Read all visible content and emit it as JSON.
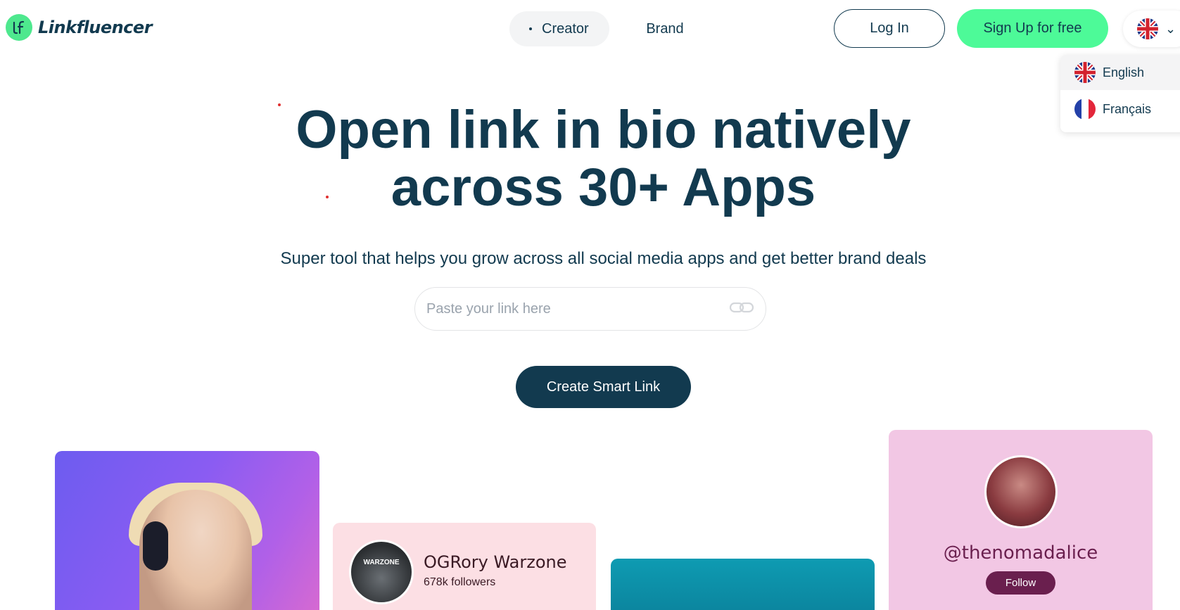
{
  "header": {
    "logo_text": "Linkfluencer",
    "nav": {
      "creator": "Creator",
      "brand": "Brand"
    },
    "login": "Log In",
    "signup": "Sign Up for free"
  },
  "language_menu": {
    "items": [
      {
        "label": "English"
      },
      {
        "label": "Français"
      }
    ]
  },
  "hero": {
    "title_line1": "Open link in bio natively",
    "title_line2": "across 30+ Apps",
    "subtitle": "Super tool that helps you grow across all social media apps and get better brand deals",
    "input_placeholder": "Paste your link here",
    "cta": "Create Smart Link"
  },
  "cards": {
    "og": {
      "name": "OGRory Warzone",
      "followers": "678k followers",
      "avatar_text": "WARZONE"
    },
    "alice": {
      "handle": "@thenomadalice",
      "follow": "Follow"
    }
  },
  "colors": {
    "brand_dark": "#123a4f",
    "brand_green": "#4dfa98",
    "pink_card": "#fcdfe4",
    "mauve_card": "#f2c7e4",
    "follow_button": "#6a1f4e"
  }
}
